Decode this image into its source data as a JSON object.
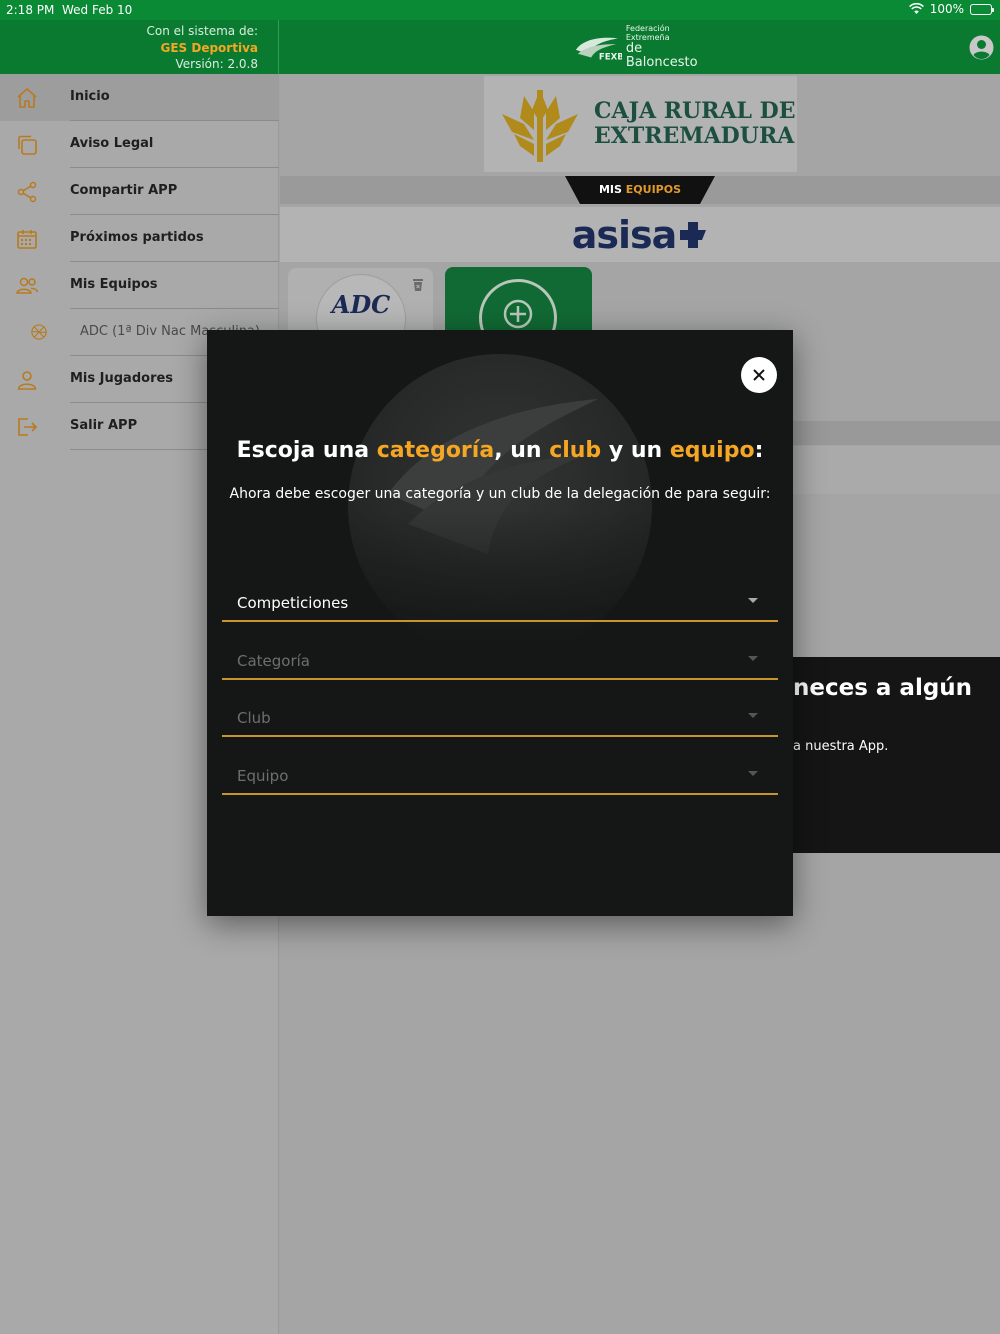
{
  "status_bar": {
    "time": "2:18 PM",
    "date": "Wed Feb 10",
    "battery": "100%"
  },
  "header": {
    "system_label": "Con el sistema de:",
    "system_name": "GES Deportiva",
    "version": "Versión: 2.0.8",
    "logo": {
      "line1": "Federación Extremeña",
      "line2": "de Baloncesto",
      "mark": "FEXB"
    }
  },
  "sidebar": {
    "items": [
      {
        "label": "Inicio",
        "icon": "home-icon"
      },
      {
        "label": "Aviso Legal",
        "icon": "copy-icon"
      },
      {
        "label": "Compartir APP",
        "icon": "share-icon"
      },
      {
        "label": "Próximos partidos",
        "icon": "calendar-icon"
      },
      {
        "label": "Mis Equipos",
        "icon": "users-icon"
      },
      {
        "label": "ADC (1ª Div Nac Masculina)",
        "icon": "basketball-icon"
      },
      {
        "label": "Mis Jugadores",
        "icon": "user-icon"
      },
      {
        "label": "Salir APP",
        "icon": "logout-icon"
      }
    ]
  },
  "main": {
    "sponsor1": {
      "line1": "CAJA RURAL DE",
      "line2": "EXTREMADURA"
    },
    "mis_equipos": {
      "prefix": "MIS",
      "highlight": "EQUIPOS"
    },
    "sponsor2": "asisa",
    "team_card_logo": "ADC",
    "promo": {
      "title": "neces a algún",
      "text": "a nuestra App."
    }
  },
  "modal": {
    "title_parts": [
      "Escoja una ",
      "categoría",
      ", un ",
      "club",
      " y un ",
      "equipo",
      ":"
    ],
    "subtitle": "Ahora debe escoger una categoría y un club de la delegación de para seguir:",
    "fields": [
      {
        "label": "Competiciones"
      },
      {
        "label": "Categoría"
      },
      {
        "label": "Club"
      },
      {
        "label": "Equipo"
      }
    ]
  },
  "colors": {
    "brand_green": "#0a7a30",
    "accent_orange": "#f5a623",
    "modal_bg": "#141716"
  }
}
